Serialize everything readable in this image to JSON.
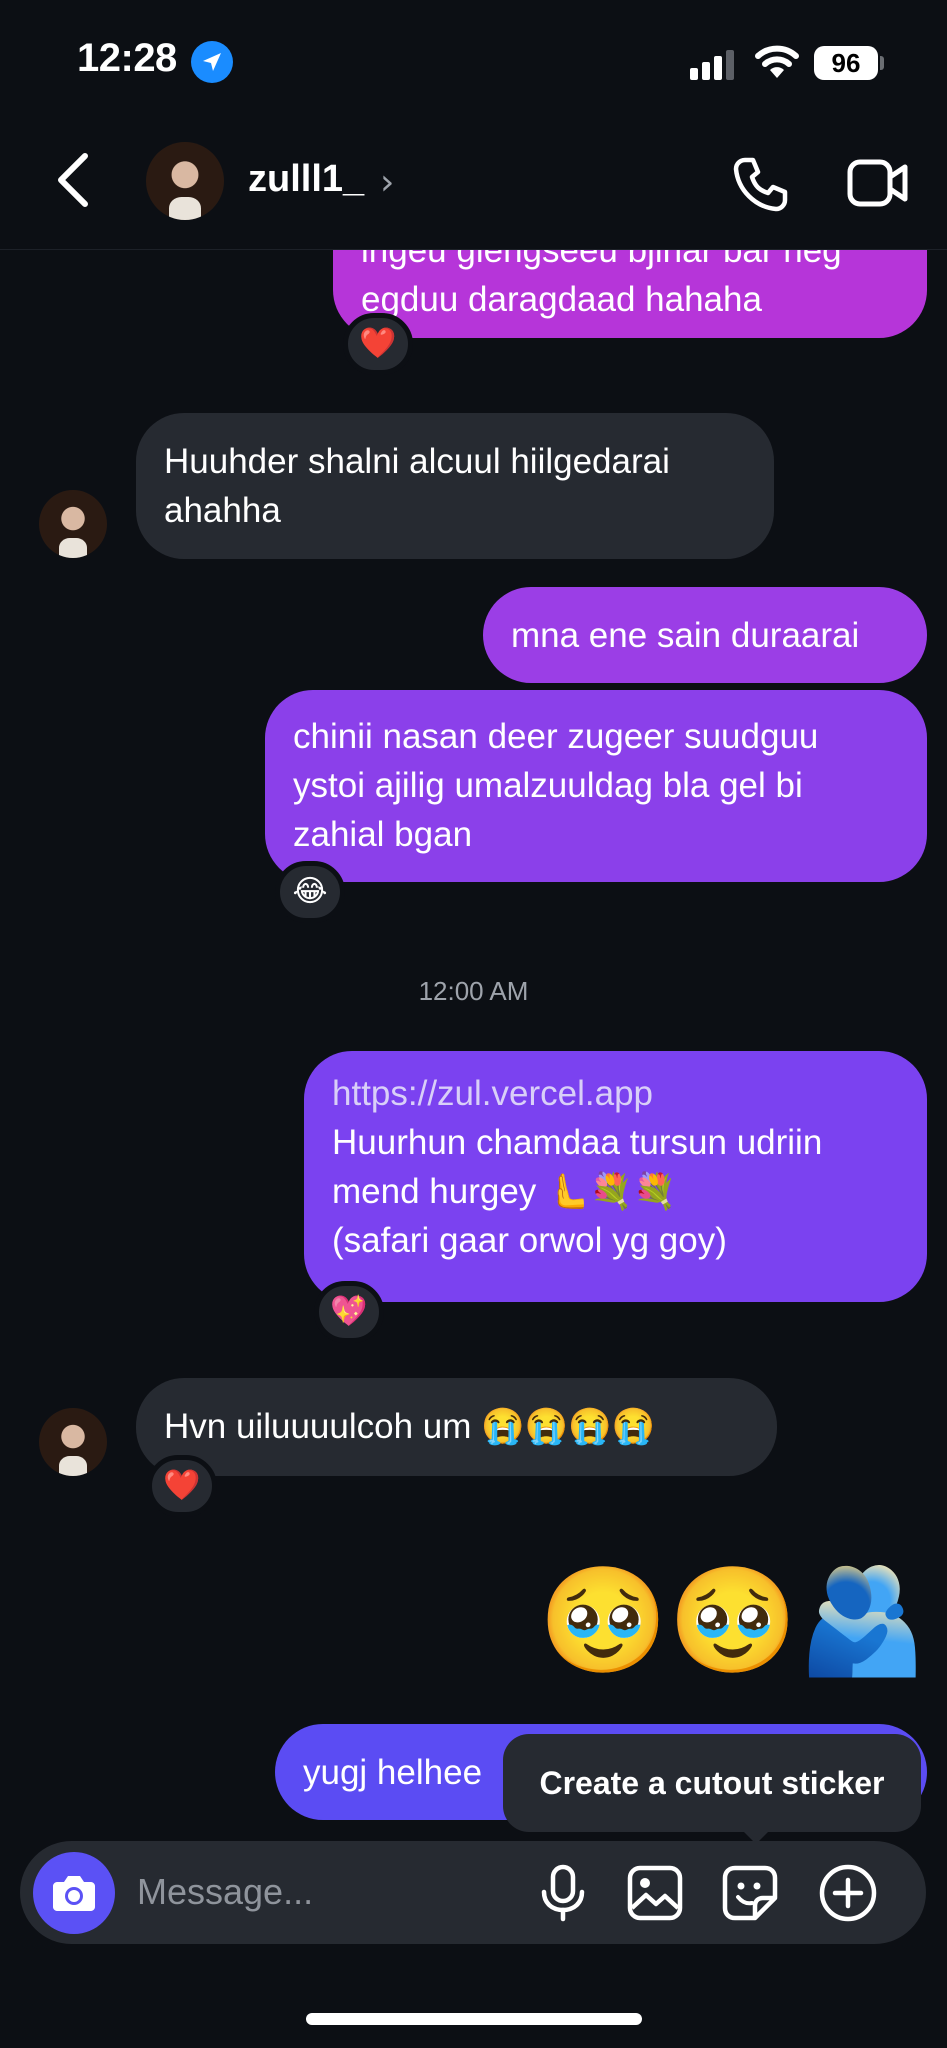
{
  "status_bar": {
    "time": "12:28",
    "battery": "96"
  },
  "header": {
    "username": "zulll1_",
    "chevron": "›"
  },
  "messages": {
    "m1_lines": [
      "ingeu glengseeu bjinar bar neg",
      "egduu daragdaad hahaha"
    ],
    "m1_reaction": "❤️",
    "m2_lines": [
      "Huuhder shalni alcuul hiilgedarai",
      "ahahha"
    ],
    "m3": "mna ene sain duraarai",
    "m4_lines": [
      "chinii nasan deer zugeer suudguu",
      "ystoi ajilig umalzuuldag bla gel bi",
      "zahial bgan"
    ],
    "m4_reaction": "😂",
    "timestamp": "12:00 AM",
    "m5_link": "https://zul.vercel.app",
    "m5_lines": [
      "Huurhun chamdaa tursun udriin",
      "mend hurgey  🫷💐💐",
      "(safari gaar orwol yg goy)"
    ],
    "m5_reaction": "💖",
    "m6": "Hvn uiluuuulcoh um 😭😭😭😭",
    "m6_reaction": "❤️",
    "m7_emojis": "🥹🥹🫂",
    "m8": "yugj helhee"
  },
  "tooltip": {
    "text": "Create a cutout sticker"
  },
  "composer": {
    "placeholder": "Message..."
  },
  "colors": {
    "background": "#0c0f14",
    "incoming": "#262a31",
    "accent_send": "#5b51f5",
    "gradient_top": "#b636d8",
    "gradient_bottom": "#5d4cf2"
  },
  "icons": [
    "back-arrow-icon",
    "location-arrow-icon",
    "signal-icon",
    "wifi-icon",
    "phone-icon",
    "video-icon",
    "camera-icon",
    "microphone-icon",
    "gallery-icon",
    "sticker-icon",
    "plus-icon"
  ]
}
